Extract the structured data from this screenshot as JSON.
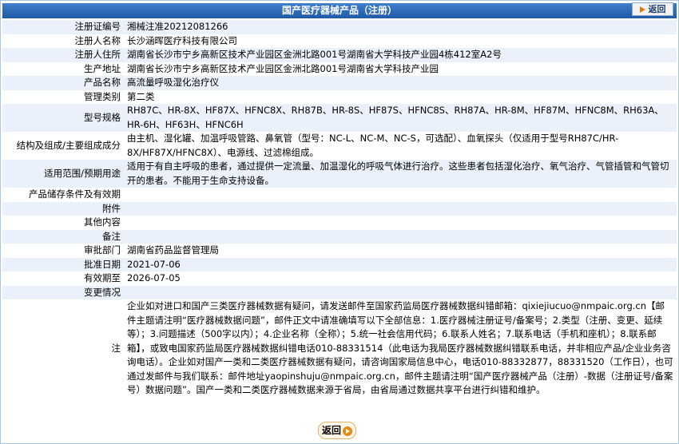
{
  "header": {
    "title": "国产医疗器械产品（注册）",
    "back_label": "返回"
  },
  "rows": [
    {
      "label": "注册证编号",
      "value": "湘械注准20212081266"
    },
    {
      "label": "注册人名称",
      "value": "长沙涵晖医疗科技有限公司"
    },
    {
      "label": "注册人住所",
      "value": "湖南省长沙市宁乡高新区技术产业园区金洲北路001号湖南省大学科技产业园4栋412室A2号"
    },
    {
      "label": "生产地址",
      "value": "湖南省长沙市宁乡高新区技术产业园区金洲北路001号湖南省大学科技产业园"
    },
    {
      "label": "产品名称",
      "value": "高流量呼吸湿化治疗仪"
    },
    {
      "label": "管理类别",
      "value": "第二类"
    },
    {
      "label": "型号规格",
      "value": "RH87C、HR-8X、HF87X、HFNC8X、RH87B、HR-8S、HF87S、HFNC8S、RH87A、HR-8M、HF87M、HFNC8M、RH63A、HR-6H、HF63H、HFNC6H"
    },
    {
      "label": "结构及组成/主要组成成分",
      "value": "由主机、湿化罐、加温呼吸管路、鼻氧管（型号：NC-L、NC-M、NC-S，可选配）、血氧探头（仅适用于型号RH87C/HR-8X/HF87X/HFNC8X）、电源线、过滤棉组成。"
    },
    {
      "label": "适用范围/预期用途",
      "value": "适用于有自主呼吸的患者，通过提供一定流量、加温湿化的呼吸气体进行治疗。这些患者包括湿化治疗、氧气治疗、气管插管和气管切开的患者。不能用于生命支持设备。"
    },
    {
      "label": "产品储存条件及有效期",
      "value": ""
    },
    {
      "label": "附件",
      "value": ""
    },
    {
      "label": "其他内容",
      "value": ""
    },
    {
      "label": "备注",
      "value": ""
    },
    {
      "label": "审批部门",
      "value": "湖南省药品监督管理局"
    },
    {
      "label": "批准日期",
      "value": "2021-07-06"
    },
    {
      "label": "有效期至",
      "value": "2026-07-05"
    },
    {
      "label": "变更情况",
      "value": ""
    },
    {
      "label": "注",
      "value": "企业如对进口和国产三类医疗器械数据有疑问，请发送邮件至国家药监局医疗器械数据纠错邮箱：qixiejiucuo@nmpaic.org.cn【邮件主题请注明“医疗器械数据问题”，邮件正文中请准确填写以下全部信息：1.医疗器械注册证号/备案号；2.类型（注册、变更、延续等）；3.问题描述（500字以内）；4.企业名称（全称）；5.统一社会信用代码；6.联系人姓名；7.联系电话（手机和座机）；8.联系邮箱】，或致电国家药监局医疗器械数据纠错电话010-88331514（此电话为我局医疗器械数据纠错联系电话，并非相应产品/企业业务咨询电话）。企业如对国产一类和二类医疗器械数据有疑问，请咨询国家局信息中心，电话010-88332877，88331520（工作日），也可通过发邮件与我们联系：邮件地址yaopinshuju@nmpaic.org.cn，邮件主题请注明“国产医疗器械产品（注册）-数据（注册证号/备案号）数据问题”。国产一类和二类医疗器械数据来源于省局，由省局通过数据共享平台进行纠错和维护。"
    }
  ],
  "footer": {
    "back_label": "返回"
  }
}
